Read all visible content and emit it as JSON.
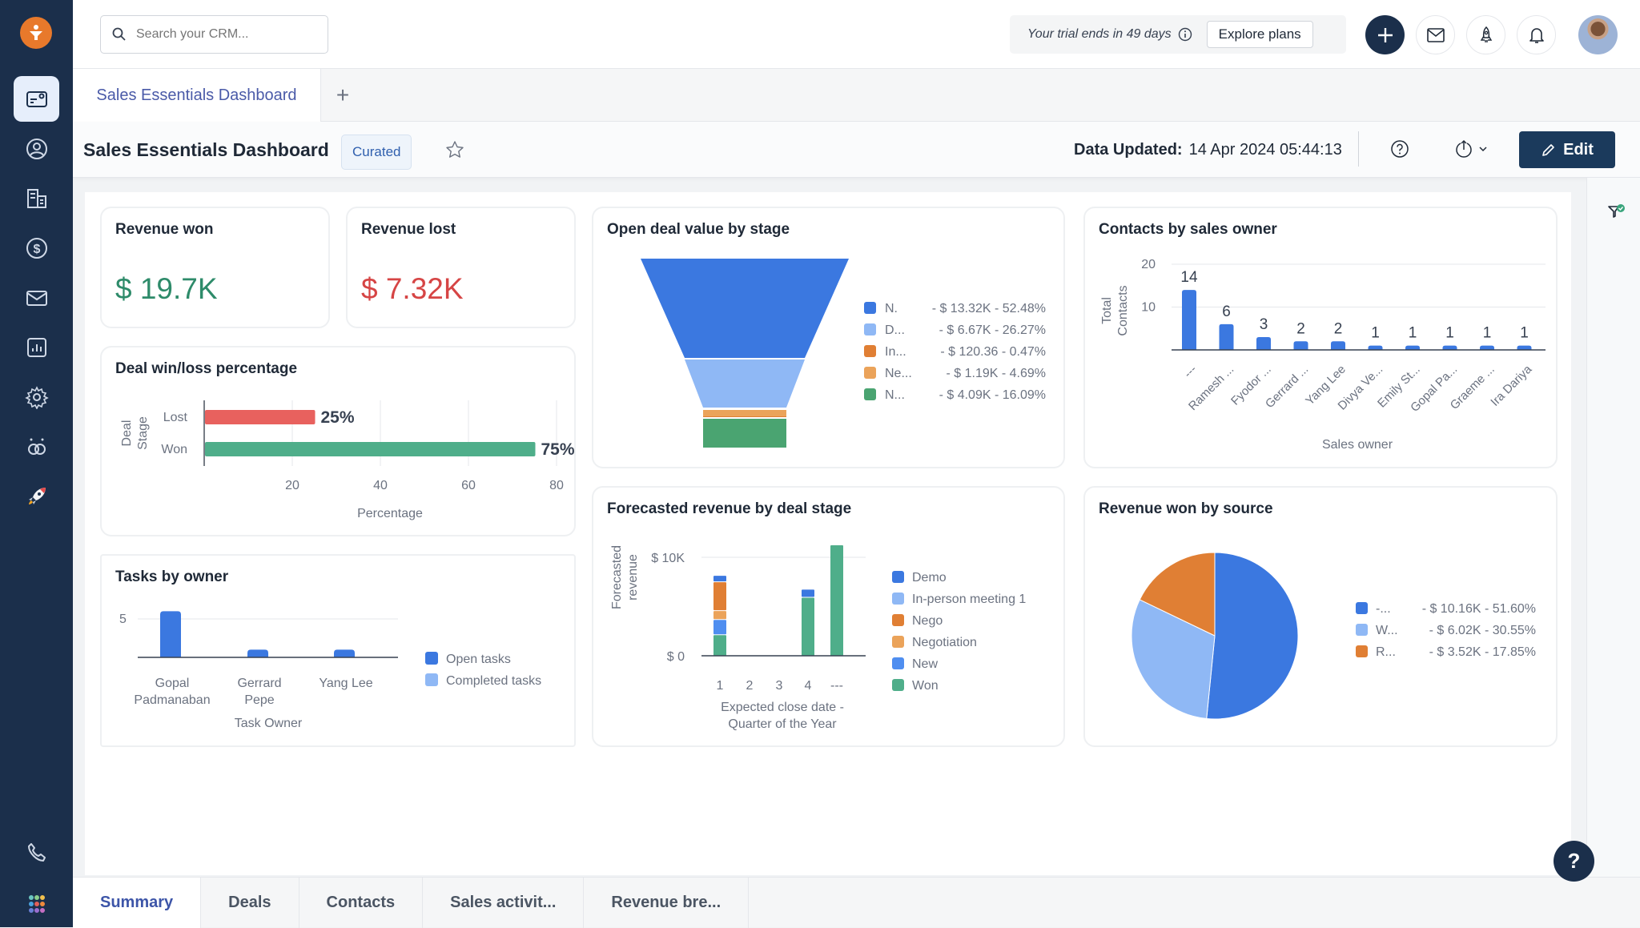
{
  "sidebar": {
    "items": [
      {
        "name": "dashboard-icon",
        "active": true
      },
      {
        "name": "contacts-icon"
      },
      {
        "name": "accounts-icon"
      },
      {
        "name": "deals-icon"
      },
      {
        "name": "email-icon"
      },
      {
        "name": "reports-icon"
      },
      {
        "name": "settings-icon"
      },
      {
        "name": "integrations-icon"
      },
      {
        "name": "rocket-icon"
      }
    ],
    "bottom": [
      {
        "name": "phone-icon"
      },
      {
        "name": "apps-grid-icon"
      }
    ]
  },
  "topbar": {
    "search_placeholder": "Search your CRM...",
    "trial_text": "Your trial ends in 49 days",
    "explore_label": "Explore plans"
  },
  "tabs": {
    "active_label": "Sales Essentials Dashboard",
    "add_label": "+"
  },
  "titlebar": {
    "title": "Sales Essentials Dashboard",
    "badge": "Curated",
    "updated_label": "Data Updated:",
    "updated_value": "14 Apr 2024 05:44:13",
    "edit_label": "Edit"
  },
  "colors": {
    "blue": "#3b78e0",
    "light_blue": "#8fb8f5",
    "orange": "#e07f34",
    "light_orange": "#eba35a",
    "green": "#4aa471",
    "teal": "#4fae8a",
    "red": "#e8615e",
    "won_green": "#2e8b6a",
    "lost_red": "#d64545"
  },
  "cards": {
    "revenue_won": {
      "title": "Revenue won",
      "value": "$ 19.7K"
    },
    "revenue_lost": {
      "title": "Revenue lost",
      "value": "$ 7.32K"
    }
  },
  "chart_data": [
    {
      "id": "winloss",
      "type": "bar",
      "orientation": "horizontal",
      "title": "Deal win/loss percentage",
      "categories": [
        "Lost",
        "Won"
      ],
      "values": [
        25,
        75
      ],
      "data_labels": [
        "25%",
        "75%"
      ],
      "xlabel": "Percentage",
      "ylabel": "Deal Stage",
      "xlim": [
        0,
        80
      ],
      "xticks": [
        "20",
        "40",
        "60",
        "80"
      ],
      "grid": true
    },
    {
      "id": "tasks",
      "type": "bar",
      "title": "Tasks by owner",
      "categories": [
        "Gopal Padmanaban",
        "Gerrard Pepe",
        "Yang Lee"
      ],
      "category_lines": [
        [
          "Gopal",
          "Padmanaban"
        ],
        [
          "Gerrard",
          "Pepe"
        ],
        [
          "Yang Lee"
        ]
      ],
      "series": [
        {
          "name": "Open tasks",
          "values": [
            6,
            1,
            1
          ]
        },
        {
          "name": "Completed tasks",
          "values": [
            0,
            0,
            0
          ]
        }
      ],
      "xlabel": "Task Owner",
      "ylabel": "",
      "ylim": [
        0,
        6
      ],
      "yticks": [
        "5"
      ],
      "legend": "right"
    },
    {
      "id": "funnel",
      "type": "funnel",
      "title": "Open deal value by stage",
      "categories": [
        "N.",
        "D...",
        "In...",
        "Ne...",
        "N..."
      ],
      "values": [
        13320,
        6670,
        120.36,
        1190,
        4090
      ],
      "value_labels": [
        "$ 13.32K",
        "$ 6.67K",
        "$ 120.36",
        "$ 1.19K",
        "$ 4.09K"
      ],
      "percents": [
        "52.48%",
        "26.27%",
        "0.47%",
        "4.69%",
        "16.09%"
      ],
      "legend": "right"
    },
    {
      "id": "contacts",
      "type": "bar",
      "title": "Contacts by sales owner",
      "categories": [
        "---",
        "Ramesh ...",
        "Fyodor ...",
        "Gerrard ...",
        "Yang Lee",
        "Divya Ve...",
        "Emily St...",
        "Gopal Pa...",
        "Graeme ...",
        "Ira Dariya"
      ],
      "values": [
        14,
        6,
        3,
        2,
        2,
        1,
        1,
        1,
        1,
        1
      ],
      "xlabel": "Sales owner",
      "ylabel": "Total Contacts",
      "ylim": [
        0,
        20
      ],
      "yticks": [
        "10",
        "20"
      ],
      "grid": true
    },
    {
      "id": "forecast",
      "type": "bar",
      "stacked": true,
      "title": "Forecasted revenue by deal stage",
      "categories": [
        "1",
        "2",
        "3",
        "4",
        "---"
      ],
      "series": [
        {
          "name": "Demo",
          "values": [
            650,
            0,
            0,
            820,
            0
          ]
        },
        {
          "name": "In-person meeting 1",
          "values": [
            0,
            0,
            0,
            0,
            0
          ]
        },
        {
          "name": "Nego",
          "values": [
            2930,
            0,
            0,
            0,
            0
          ]
        },
        {
          "name": "Negotiation",
          "values": [
            900,
            0,
            0,
            0,
            0
          ]
        },
        {
          "name": "New",
          "values": [
            1550,
            0,
            0,
            0,
            0
          ]
        },
        {
          "name": "Won",
          "values": [
            2170,
            0,
            0,
            5980,
            11300
          ]
        }
      ],
      "xlabel": "Expected close date - Quarter of the Year",
      "xlabel_lines": [
        "Expected close date -",
        "Quarter of the Year"
      ],
      "ylabel": "Forecasted revenue",
      "ylim": [
        0,
        11500
      ],
      "yticks": [
        "$ 0",
        "$ 10K"
      ],
      "legend": "right"
    },
    {
      "id": "source",
      "type": "pie",
      "title": "Revenue won by source",
      "categories": [
        "-...",
        "W...",
        "R..."
      ],
      "values": [
        10160,
        6020,
        3520
      ],
      "value_labels": [
        "$ 10.16K",
        "$ 6.02K",
        "$ 3.52K"
      ],
      "percents": [
        "51.60%",
        "30.55%",
        "17.85%"
      ],
      "legend": "right"
    }
  ],
  "bottom_tabs": [
    {
      "label": "Summary",
      "active": true
    },
    {
      "label": "Deals"
    },
    {
      "label": "Contacts"
    },
    {
      "label": "Sales activit..."
    },
    {
      "label": "Revenue bre..."
    }
  ],
  "help_fab": "?"
}
